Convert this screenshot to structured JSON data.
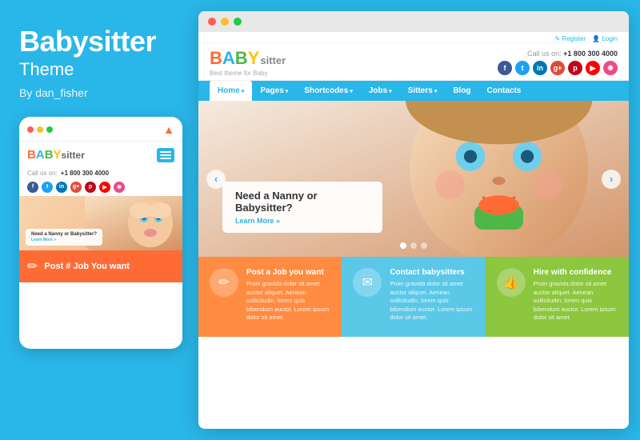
{
  "left": {
    "brand_title": "Babysitter",
    "brand_subtitle": "Theme",
    "brand_author": "By dan_fisher",
    "mobile": {
      "call_label": "Call us on:",
      "call_number": "+1 800 300 4000",
      "logo_letters": [
        "B",
        "A",
        "B",
        "Y"
      ],
      "logo_sitter": "sitter",
      "hero_heading": "Need a Nanny or Babysitter?",
      "hero_link": "Learn More »",
      "post_bar_text": "Post # Job You want"
    }
  },
  "browser": {
    "site_logo_letters": [
      "B",
      "A",
      "B",
      "Y"
    ],
    "site_logo_sitter": "sitter",
    "site_tagline": "Best theme for Baby",
    "call_label": "Call us on:",
    "call_number": "+1 800 300 4000",
    "auth_links": [
      "Register",
      "Login"
    ],
    "nav_items": [
      {
        "label": "Home",
        "active": true,
        "has_arrow": true
      },
      {
        "label": "Pages",
        "has_arrow": true
      },
      {
        "label": "Shortcodes",
        "has_arrow": true
      },
      {
        "label": "Jobs",
        "has_arrow": true
      },
      {
        "label": "Sitters",
        "has_arrow": true
      },
      {
        "label": "Blog"
      },
      {
        "label": "Contacts"
      }
    ],
    "hero": {
      "heading": "Need a Nanny or Babysitter?",
      "link": "Learn More »"
    },
    "cards": [
      {
        "icon": "✏",
        "title": "Post a Job you want",
        "text": "Proin gravida dolor sit amet auctor aliquet. Aenean sollicitudin, lorem quis bibendum auctor. Lorem ipsum dolor sit amet.",
        "color": "card-orange"
      },
      {
        "icon": "✉",
        "title": "Contact babysitters",
        "text": "Proin gravida dolor sit amet auctor aliquet. Aenean sollicitudin, lorem quis bibendum auctor. Lorem ipsum dolor sit amet.",
        "color": "card-blue"
      },
      {
        "icon": "👍",
        "title": "Hire with confidence",
        "text": "Proin gravida dolor sit amet auctor aliquet. Aenean sollicitudin, lorem quis bibendum auctor. Lorem ipsum dolor sit amet.",
        "color": "card-green"
      }
    ]
  },
  "social_colors": {
    "fb": "#3b5998",
    "tw": "#1da1f2",
    "in": "#0077b5",
    "gp": "#dd4b39",
    "pi": "#bd081c",
    "yt": "#ff0000",
    "dn": "#ea4c89"
  },
  "dots": {
    "red": "#ff5f57",
    "yellow": "#febc2e",
    "green": "#28c840"
  },
  "mobile_dots": {
    "red": "#ff5f57",
    "yellow": "#febc2e",
    "green": "#28c840"
  }
}
